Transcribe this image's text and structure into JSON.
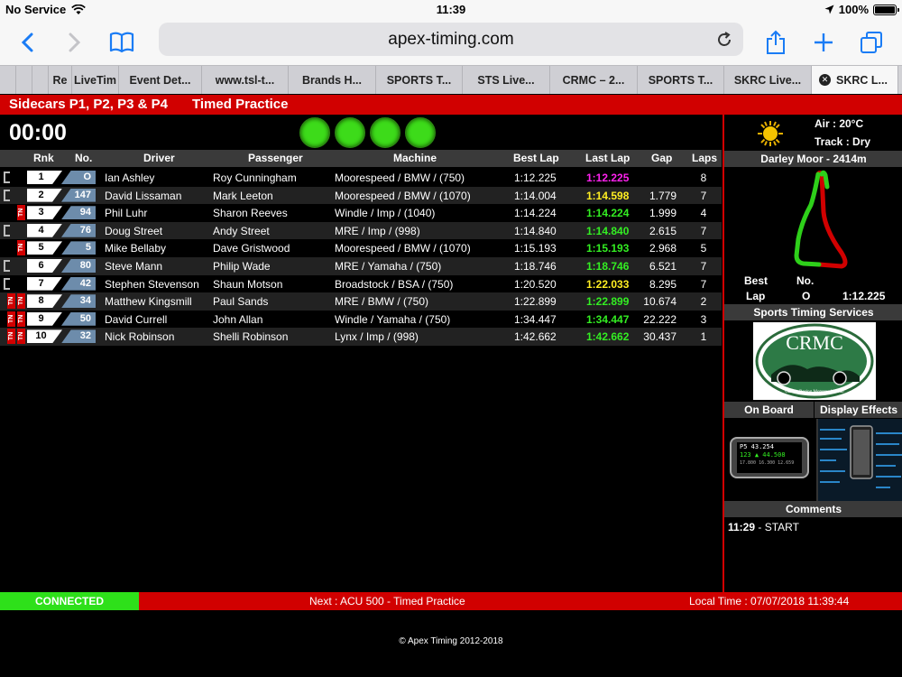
{
  "status_bar": {
    "carrier": "No Service",
    "time": "11:39",
    "battery": "100%"
  },
  "browser": {
    "url": "apex-timing.com"
  },
  "tabs": [
    {
      "label": "",
      "width": 18
    },
    {
      "label": "",
      "width": 18
    },
    {
      "label": "",
      "width": 18
    },
    {
      "label": "Re",
      "width": 26
    },
    {
      "label": "LiveTim",
      "width": 52
    },
    {
      "label": "Event Det...",
      "width": 92
    },
    {
      "label": "www.tsl-t...",
      "width": 96
    },
    {
      "label": "Brands H...",
      "width": 97
    },
    {
      "label": "SPORTS T...",
      "width": 96
    },
    {
      "label": "STS Live...",
      "width": 97
    },
    {
      "label": "CRMC – 2...",
      "width": 97
    },
    {
      "label": "SPORTS T...",
      "width": 96
    },
    {
      "label": "SKRC Live...",
      "width": 97
    },
    {
      "label": "SKRC L...",
      "width": 96,
      "active": true
    }
  ],
  "header": {
    "session": "Sidecars P1, P2, P3 & P4",
    "type": "Timed Practice",
    "clock": "00:00"
  },
  "columns": {
    "rnk": "Rnk",
    "no": "No.",
    "driver": "Driver",
    "passenger": "Passenger",
    "machine": "Machine",
    "best": "Best Lap",
    "last": "Last Lap",
    "gap": "Gap",
    "laps": "Laps"
  },
  "rows": [
    {
      "rnk": "1",
      "no": "O",
      "driver": "Ian Ashley",
      "passenger": "Roy Cunningham",
      "machine": "Moorespeed / BMW / (750)",
      "best": "1:12.225",
      "last": "1:12.225",
      "last_color": "purple",
      "gap": "",
      "laps": "8",
      "tn": false,
      "bracket": true
    },
    {
      "rnk": "2",
      "no": "147",
      "driver": "David Lissaman",
      "passenger": "Mark Leeton",
      "machine": "Moorespeed / BMW / (1070)",
      "best": "1:14.004",
      "last": "1:14.598",
      "last_color": "yellow",
      "gap": "1.779",
      "laps": "7",
      "tn": false,
      "bracket": true
    },
    {
      "rnk": "3",
      "no": "94",
      "driver": "Phil Luhr",
      "passenger": "Sharon Reeves",
      "machine": "Windle / Imp / (1040)",
      "best": "1:14.224",
      "last": "1:14.224",
      "last_color": "green",
      "gap": "1.999",
      "laps": "4",
      "tn": true,
      "bracket": false
    },
    {
      "rnk": "4",
      "no": "76",
      "driver": "Doug Street",
      "passenger": "Andy Street",
      "machine": "MRE / Imp / (998)",
      "best": "1:14.840",
      "last": "1:14.840",
      "last_color": "green",
      "gap": "2.615",
      "laps": "7",
      "tn": false,
      "bracket": true
    },
    {
      "rnk": "5",
      "no": "5",
      "driver": "Mike Bellaby",
      "passenger": "Dave Gristwood",
      "machine": "Moorespeed / BMW / (1070)",
      "best": "1:15.193",
      "last": "1:15.193",
      "last_color": "green",
      "gap": "2.968",
      "laps": "5",
      "tn": true,
      "bracket": false
    },
    {
      "rnk": "6",
      "no": "80",
      "driver": "Steve Mann",
      "passenger": "Philip Wade",
      "machine": "MRE / Yamaha / (750)",
      "best": "1:18.746",
      "last": "1:18.746",
      "last_color": "green",
      "gap": "6.521",
      "laps": "7",
      "tn": false,
      "bracket": true
    },
    {
      "rnk": "7",
      "no": "42",
      "driver": "Stephen Stevenson",
      "passenger": "Shaun Motson",
      "machine": "Broadstock / BSA / (750)",
      "best": "1:20.520",
      "last": "1:22.033",
      "last_color": "yellow",
      "gap": "8.295",
      "laps": "7",
      "tn": false,
      "bracket": true
    },
    {
      "rnk": "8",
      "no": "34",
      "driver": "Matthew Kingsmill",
      "passenger": "Paul Sands",
      "machine": "MRE / BMW / (750)",
      "best": "1:22.899",
      "last": "1:22.899",
      "last_color": "green",
      "gap": "10.674",
      "laps": "2",
      "tn": true,
      "bracket": false,
      "tn2": true
    },
    {
      "rnk": "9",
      "no": "50",
      "driver": "David Currell",
      "passenger": "John Allan",
      "machine": "Windle / Yamaha / (750)",
      "best": "1:34.447",
      "last": "1:34.447",
      "last_color": "green",
      "gap": "22.222",
      "laps": "3",
      "tn": true,
      "bracket": false,
      "tn2": true
    },
    {
      "rnk": "10",
      "no": "32",
      "driver": "Nick Robinson",
      "passenger": "Shelli Robinson",
      "machine": "Lynx / Imp / (998)",
      "best": "1:42.662",
      "last": "1:42.662",
      "last_color": "green",
      "gap": "30.437",
      "laps": "1",
      "tn": true,
      "bracket": false,
      "tn2": true
    }
  ],
  "tn_label": "TN",
  "weather": {
    "air": "Air : 20°C",
    "track": "Track : Dry"
  },
  "circuit": {
    "name": "Darley Moor - 2414m"
  },
  "best_lap": {
    "best_label": "Best",
    "no_label": "No.",
    "lap_label": "Lap",
    "no": "O",
    "time": "1:12.225"
  },
  "sponsor": {
    "title": "Sports Timing Services",
    "logo_text": "CRMC",
    "logo_sub": "Classic Racing Motorcycle Club"
  },
  "features": {
    "onboard": "On Board",
    "effects": "Display Effects",
    "phone_lines": [
      "P5     43.254",
      "123 ▲ 44.508",
      "17.800 16.300 12.659"
    ]
  },
  "comments": {
    "title": "Comments",
    "entries": [
      {
        "time": "11:29",
        "text": " - START"
      }
    ]
  },
  "footer": {
    "connected": "CONNECTED",
    "next": "Next : ACU 500 - Timed Practice",
    "local_time": "Local Time : 07/07/2018 11:39:44",
    "copyright": "© Apex Timing 2012-2018"
  },
  "colors": {
    "red": "#d10000",
    "green": "#33ee22",
    "yellow": "#ffee22",
    "purple": "#ff22ee",
    "ios_blue": "#1a7cf5"
  }
}
